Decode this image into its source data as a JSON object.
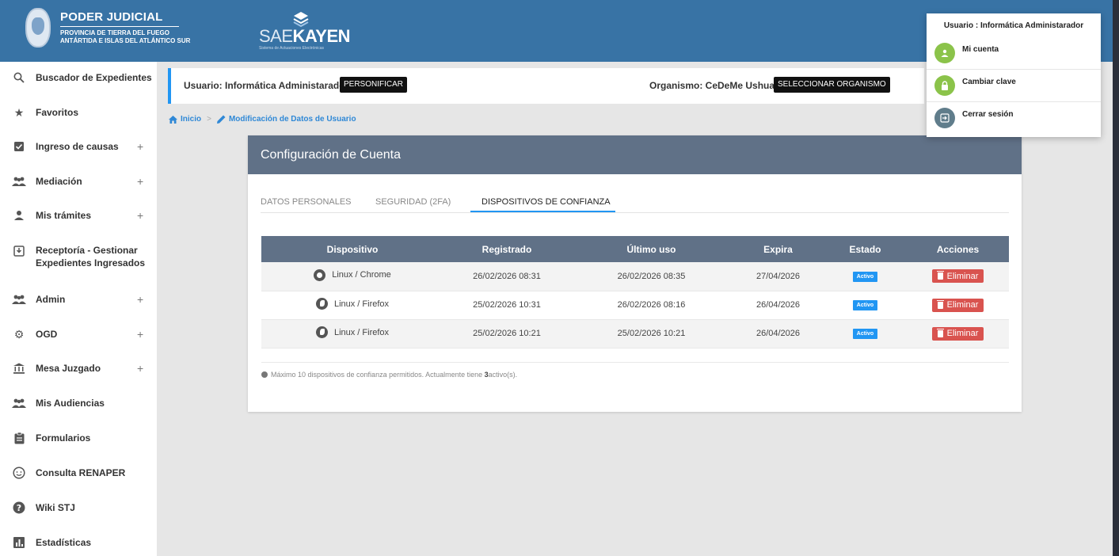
{
  "header": {
    "brand_title": "PODER JUDICIAL",
    "brand_sub_1": "PROVINCIA DE TIERRA DEL FUEGO",
    "brand_sub_2": "ANTÁRTIDA E ISLAS DEL ATLÁNTICO SUR",
    "app_name_thin": "SAE",
    "app_name_bold": "KAYEN",
    "app_tagline": "Sistema de Actuaciones Electrónicas"
  },
  "sidebar": {
    "items": [
      {
        "label": "Buscador de Expedientes",
        "icon": "search-icon"
      },
      {
        "label": "Favoritos",
        "icon": "star-icon"
      },
      {
        "label": "Ingreso de causas",
        "icon": "checkbox-icon",
        "expandable": true
      },
      {
        "label": "Mediación",
        "icon": "group-icon",
        "expandable": true
      },
      {
        "label": "Mis trámites",
        "icon": "person-icon",
        "expandable": true
      },
      {
        "label": "Receptoría - Gestionar",
        "label2": "Expedientes Ingresados",
        "icon": "inbox-icon"
      },
      {
        "label": "Admin",
        "icon": "group-icon",
        "expandable": true
      },
      {
        "label": "OGD",
        "icon": "gear-icon",
        "expandable": true
      },
      {
        "label": "Mesa Juzgado",
        "icon": "bank-icon",
        "expandable": true
      },
      {
        "label": "Mis Audiencias",
        "icon": "group-icon"
      },
      {
        "label": "Formularios",
        "icon": "clipboard-icon"
      },
      {
        "label": "Consulta RENAPER",
        "icon": "face-icon"
      },
      {
        "label": "Wiki STJ",
        "icon": "help-icon"
      },
      {
        "label": "Estadísticas",
        "icon": "chart-icon"
      }
    ],
    "plus": "+"
  },
  "infobar": {
    "user_text": "Usuario: Informática Administarador",
    "personify_label": "PERSONIFICAR",
    "org_text": "Organismo: CeDeMe Ushuaia",
    "select_org_label": "SELECCIONAR ORGANISMO"
  },
  "breadcrumb": {
    "home": "Inicio",
    "separator": ">",
    "current": "Modificación de Datos de Usuario"
  },
  "card": {
    "title": "Configuración de Cuenta",
    "tabs": [
      {
        "label": "DATOS PERSONALES",
        "active": false
      },
      {
        "label": "SEGURIDAD (2FA)",
        "active": false
      },
      {
        "label": "DISPOSITIVOS DE CONFIANZA",
        "active": true
      }
    ],
    "table": {
      "headers": [
        "Dispositivo",
        "Registrado",
        "Último uso",
        "Expira",
        "Estado",
        "Acciones"
      ],
      "rows": [
        {
          "browser_icon": "chrome-icon",
          "device": "Linux / Chrome",
          "registered": "26/02/2026 08:31",
          "last_used": "26/02/2026 08:35",
          "expires": "27/04/2026",
          "status": "Activo",
          "action": "Eliminar"
        },
        {
          "browser_icon": "firefox-icon",
          "device": "Linux / Firefox",
          "registered": "25/02/2026 10:31",
          "last_used": "26/02/2026 08:16",
          "expires": "26/04/2026",
          "status": "Activo",
          "action": "Eliminar"
        },
        {
          "browser_icon": "firefox-icon",
          "device": "Linux / Firefox",
          "registered": "25/02/2026 10:21",
          "last_used": "25/02/2026 10:21",
          "expires": "26/04/2026",
          "status": "Activo",
          "action": "Eliminar"
        }
      ]
    },
    "note_prefix": "Máximo 10 dispositivos de confianza permitidos. Actualmente tiene ",
    "note_count": "3",
    "note_suffix": " activo(s)."
  },
  "dropdown": {
    "title": "Usuario : Informática Administarador",
    "items": [
      {
        "label": "Mi cuenta",
        "icon": "person-icon",
        "color": "#8bc34a"
      },
      {
        "label": "Cambiar clave",
        "icon": "lock-icon",
        "color": "#8bc34a"
      },
      {
        "label": "Cerrar sesión",
        "icon": "logout-icon",
        "color": "#607d8b"
      }
    ]
  },
  "colors": {
    "header_bg": "#3873a5",
    "card_header": "#607187",
    "accent": "#2196f3",
    "danger": "#d9534f"
  }
}
